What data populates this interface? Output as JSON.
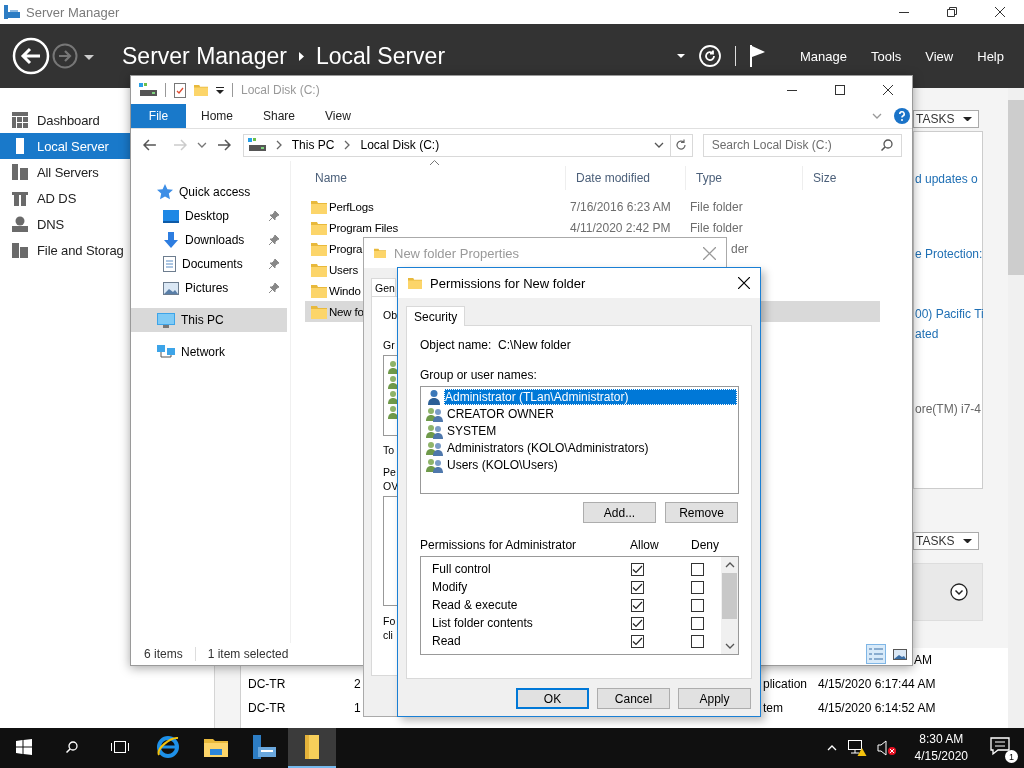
{
  "server_manager": {
    "title": "Server Manager",
    "breadcrumb": [
      "Server Manager",
      "Local Server"
    ],
    "menu": [
      "Manage",
      "Tools",
      "View",
      "Help"
    ],
    "nav": [
      {
        "label": "Dashboard",
        "selected": false
      },
      {
        "label": "Local Server",
        "selected": true
      },
      {
        "label": "All Servers",
        "selected": false
      },
      {
        "label": "AD DS",
        "selected": false
      },
      {
        "label": "DNS",
        "selected": false
      },
      {
        "label": "File and Storag",
        "selected": false
      }
    ],
    "tiles": [
      {
        "button": "TASKS",
        "lines": [
          {
            "text": "d updates o",
            "kind": "link"
          },
          {
            "text": "e Protection:",
            "kind": "link"
          },
          {
            "text": "00) Pacific Ti",
            "kind": "link"
          },
          {
            "text": "ated",
            "kind": "link"
          },
          {
            "text": "ore(TM) i7-4",
            "kind": "text"
          }
        ]
      },
      {
        "button": "TASKS"
      }
    ],
    "events": [
      {
        "time": "AM"
      },
      {
        "server": "DC-TR",
        "id": "2",
        "source": "plication",
        "time": "4/15/2020 6:17:44 AM"
      },
      {
        "server": "DC-TR",
        "id": "1",
        "source": "tem",
        "time": "4/15/2020 6:14:52 AM"
      }
    ]
  },
  "explorer": {
    "title": "Local Disk (C:)",
    "ribbon_tabs": [
      {
        "label": "File",
        "selected": true
      },
      {
        "label": "Home",
        "selected": false
      },
      {
        "label": "Share",
        "selected": false
      },
      {
        "label": "View",
        "selected": false
      }
    ],
    "path": [
      "This PC",
      "Local Disk (C:)"
    ],
    "search": {
      "placeholder": "Search Local Disk (C:)"
    },
    "nav": [
      {
        "label": "Quick access",
        "selected": false,
        "children": [
          {
            "label": "Desktop",
            "pinned": true
          },
          {
            "label": "Downloads",
            "pinned": true
          },
          {
            "label": "Documents",
            "pinned": true
          },
          {
            "label": "Pictures",
            "pinned": true
          }
        ]
      },
      {
        "label": "This PC",
        "selected": true
      },
      {
        "label": "Network",
        "selected": false
      }
    ],
    "columns": [
      "Name",
      "Date modified",
      "Type",
      "Size"
    ],
    "files": [
      {
        "kind": "full",
        "name": "PerfLogs",
        "date": "7/16/2016 6:23 AM",
        "type": "File folder",
        "selected": false
      },
      {
        "kind": "full",
        "name": "Program Files",
        "date": "4/11/2020 2:42 PM",
        "type": "File folder",
        "selected": false
      },
      {
        "kind": "covered",
        "name": "Progra",
        "type": "der",
        "selected": false
      },
      {
        "kind": "covered",
        "name": "Users",
        "selected": false
      },
      {
        "kind": "covered",
        "name": "Windo",
        "selected": false
      },
      {
        "kind": "covered",
        "name": "New fo",
        "selected": true
      }
    ],
    "status": [
      "6 items",
      "1 item selected"
    ]
  },
  "properties": {
    "title": "New folder Properties",
    "tab": "Gen",
    "labels": [
      "Ob",
      "Gr",
      "To",
      "Pe",
      "OV",
      "Fo",
      "cli"
    ]
  },
  "permissions": {
    "title": "Permissions for New folder",
    "tabs": [
      {
        "label": "Security",
        "selected": true
      }
    ],
    "object_label": "Object name:",
    "object_name": "C:\\New folder",
    "users_label": "Group or user names:",
    "users": [
      {
        "name": "Administrator (TLan\\Administrator)",
        "kind": "user",
        "selected": true
      },
      {
        "name": "CREATOR OWNER",
        "kind": "group",
        "selected": false
      },
      {
        "name": "SYSTEM",
        "kind": "group",
        "selected": false
      },
      {
        "name": "Administrators (KOLO\\Administrators)",
        "kind": "group",
        "selected": false
      },
      {
        "name": "Users (KOLO\\Users)",
        "kind": "group",
        "selected": false
      }
    ],
    "user_buttons": [
      "Add...",
      "Remove"
    ],
    "perms_label": "Permissions for Administrator",
    "perm_columns": [
      "Allow",
      "Deny"
    ],
    "perms": [
      {
        "name": "Full control",
        "allow": true,
        "deny": false
      },
      {
        "name": "Modify",
        "allow": true,
        "deny": false
      },
      {
        "name": "Read & execute",
        "allow": true,
        "deny": false
      },
      {
        "name": "List folder contents",
        "allow": true,
        "deny": false
      },
      {
        "name": "Read",
        "allow": true,
        "deny": false
      }
    ],
    "buttons": [
      {
        "label": "OK",
        "default": true
      },
      {
        "label": "Cancel",
        "default": false
      },
      {
        "label": "Apply",
        "default": false
      }
    ]
  },
  "taskbar": {
    "apps": [
      {
        "selected": false
      },
      {
        "selected": false
      },
      {
        "selected": false
      },
      {
        "selected": true
      }
    ],
    "time": "8:30 AM",
    "date": "4/15/2020",
    "notifications": "1"
  }
}
